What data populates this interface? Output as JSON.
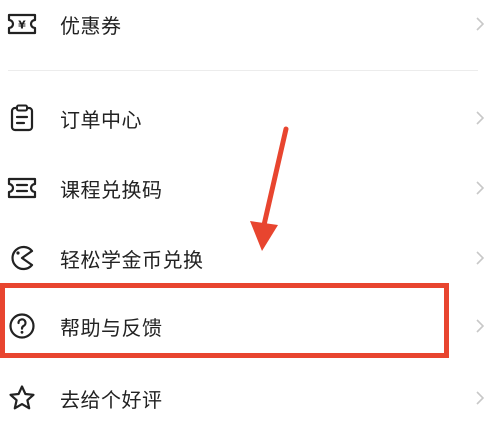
{
  "menu": {
    "coupon": {
      "label": "优惠券",
      "icon": "coupon-icon"
    },
    "orders": {
      "label": "订单中心",
      "icon": "clipboard-icon"
    },
    "redeem": {
      "label": "课程兑换码",
      "icon": "ticket-icon"
    },
    "gold": {
      "label": "轻松学金币兑换",
      "icon": "pacman-coin-icon"
    },
    "help": {
      "label": "帮助与反馈",
      "icon": "question-circle-icon"
    },
    "review": {
      "label": "去给个好评",
      "icon": "star-icon"
    }
  },
  "annotation": {
    "color": "#e8452f"
  }
}
